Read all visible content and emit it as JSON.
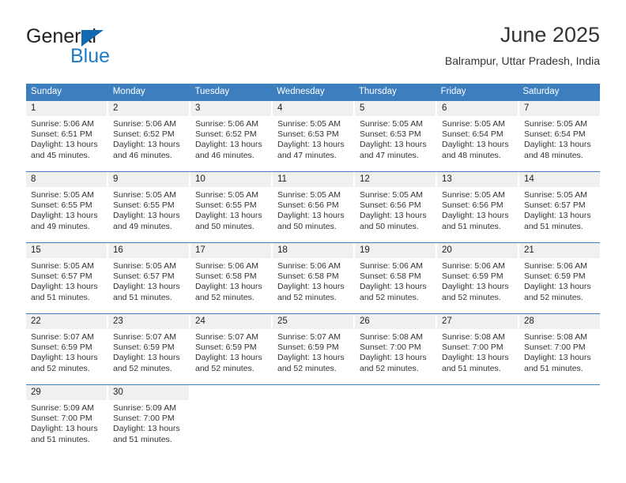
{
  "brand": {
    "name_top": "General",
    "name_bottom": "Blue",
    "accent_color": "#1269b0",
    "blue_text_color": "#1e7ac4"
  },
  "header": {
    "title": "June 2025",
    "subtitle": "Balrampur, Uttar Pradesh, India"
  },
  "theme": {
    "header_bar_color": "#3d7ebf",
    "day_number_bg": "#f0f0f0",
    "text_color": "#333333"
  },
  "calendar": {
    "weekdays": [
      "Sunday",
      "Monday",
      "Tuesday",
      "Wednesday",
      "Thursday",
      "Friday",
      "Saturday"
    ],
    "labels": {
      "sunrise": "Sunrise:",
      "sunset": "Sunset:",
      "daylight": "Daylight:"
    },
    "weeks": [
      [
        {
          "day": "1",
          "sunrise": "Sunrise: 5:06 AM",
          "sunset": "Sunset: 6:51 PM",
          "daylight_line1": "Daylight: 13 hours",
          "daylight_line2": "and 45 minutes."
        },
        {
          "day": "2",
          "sunrise": "Sunrise: 5:06 AM",
          "sunset": "Sunset: 6:52 PM",
          "daylight_line1": "Daylight: 13 hours",
          "daylight_line2": "and 46 minutes."
        },
        {
          "day": "3",
          "sunrise": "Sunrise: 5:06 AM",
          "sunset": "Sunset: 6:52 PM",
          "daylight_line1": "Daylight: 13 hours",
          "daylight_line2": "and 46 minutes."
        },
        {
          "day": "4",
          "sunrise": "Sunrise: 5:05 AM",
          "sunset": "Sunset: 6:53 PM",
          "daylight_line1": "Daylight: 13 hours",
          "daylight_line2": "and 47 minutes."
        },
        {
          "day": "5",
          "sunrise": "Sunrise: 5:05 AM",
          "sunset": "Sunset: 6:53 PM",
          "daylight_line1": "Daylight: 13 hours",
          "daylight_line2": "and 47 minutes."
        },
        {
          "day": "6",
          "sunrise": "Sunrise: 5:05 AM",
          "sunset": "Sunset: 6:54 PM",
          "daylight_line1": "Daylight: 13 hours",
          "daylight_line2": "and 48 minutes."
        },
        {
          "day": "7",
          "sunrise": "Sunrise: 5:05 AM",
          "sunset": "Sunset: 6:54 PM",
          "daylight_line1": "Daylight: 13 hours",
          "daylight_line2": "and 48 minutes."
        }
      ],
      [
        {
          "day": "8",
          "sunrise": "Sunrise: 5:05 AM",
          "sunset": "Sunset: 6:55 PM",
          "daylight_line1": "Daylight: 13 hours",
          "daylight_line2": "and 49 minutes."
        },
        {
          "day": "9",
          "sunrise": "Sunrise: 5:05 AM",
          "sunset": "Sunset: 6:55 PM",
          "daylight_line1": "Daylight: 13 hours",
          "daylight_line2": "and 49 minutes."
        },
        {
          "day": "10",
          "sunrise": "Sunrise: 5:05 AM",
          "sunset": "Sunset: 6:55 PM",
          "daylight_line1": "Daylight: 13 hours",
          "daylight_line2": "and 50 minutes."
        },
        {
          "day": "11",
          "sunrise": "Sunrise: 5:05 AM",
          "sunset": "Sunset: 6:56 PM",
          "daylight_line1": "Daylight: 13 hours",
          "daylight_line2": "and 50 minutes."
        },
        {
          "day": "12",
          "sunrise": "Sunrise: 5:05 AM",
          "sunset": "Sunset: 6:56 PM",
          "daylight_line1": "Daylight: 13 hours",
          "daylight_line2": "and 50 minutes."
        },
        {
          "day": "13",
          "sunrise": "Sunrise: 5:05 AM",
          "sunset": "Sunset: 6:56 PM",
          "daylight_line1": "Daylight: 13 hours",
          "daylight_line2": "and 51 minutes."
        },
        {
          "day": "14",
          "sunrise": "Sunrise: 5:05 AM",
          "sunset": "Sunset: 6:57 PM",
          "daylight_line1": "Daylight: 13 hours",
          "daylight_line2": "and 51 minutes."
        }
      ],
      [
        {
          "day": "15",
          "sunrise": "Sunrise: 5:05 AM",
          "sunset": "Sunset: 6:57 PM",
          "daylight_line1": "Daylight: 13 hours",
          "daylight_line2": "and 51 minutes."
        },
        {
          "day": "16",
          "sunrise": "Sunrise: 5:05 AM",
          "sunset": "Sunset: 6:57 PM",
          "daylight_line1": "Daylight: 13 hours",
          "daylight_line2": "and 51 minutes."
        },
        {
          "day": "17",
          "sunrise": "Sunrise: 5:06 AM",
          "sunset": "Sunset: 6:58 PM",
          "daylight_line1": "Daylight: 13 hours",
          "daylight_line2": "and 52 minutes."
        },
        {
          "day": "18",
          "sunrise": "Sunrise: 5:06 AM",
          "sunset": "Sunset: 6:58 PM",
          "daylight_line1": "Daylight: 13 hours",
          "daylight_line2": "and 52 minutes."
        },
        {
          "day": "19",
          "sunrise": "Sunrise: 5:06 AM",
          "sunset": "Sunset: 6:58 PM",
          "daylight_line1": "Daylight: 13 hours",
          "daylight_line2": "and 52 minutes."
        },
        {
          "day": "20",
          "sunrise": "Sunrise: 5:06 AM",
          "sunset": "Sunset: 6:59 PM",
          "daylight_line1": "Daylight: 13 hours",
          "daylight_line2": "and 52 minutes."
        },
        {
          "day": "21",
          "sunrise": "Sunrise: 5:06 AM",
          "sunset": "Sunset: 6:59 PM",
          "daylight_line1": "Daylight: 13 hours",
          "daylight_line2": "and 52 minutes."
        }
      ],
      [
        {
          "day": "22",
          "sunrise": "Sunrise: 5:07 AM",
          "sunset": "Sunset: 6:59 PM",
          "daylight_line1": "Daylight: 13 hours",
          "daylight_line2": "and 52 minutes."
        },
        {
          "day": "23",
          "sunrise": "Sunrise: 5:07 AM",
          "sunset": "Sunset: 6:59 PM",
          "daylight_line1": "Daylight: 13 hours",
          "daylight_line2": "and 52 minutes."
        },
        {
          "day": "24",
          "sunrise": "Sunrise: 5:07 AM",
          "sunset": "Sunset: 6:59 PM",
          "daylight_line1": "Daylight: 13 hours",
          "daylight_line2": "and 52 minutes."
        },
        {
          "day": "25",
          "sunrise": "Sunrise: 5:07 AM",
          "sunset": "Sunset: 6:59 PM",
          "daylight_line1": "Daylight: 13 hours",
          "daylight_line2": "and 52 minutes."
        },
        {
          "day": "26",
          "sunrise": "Sunrise: 5:08 AM",
          "sunset": "Sunset: 7:00 PM",
          "daylight_line1": "Daylight: 13 hours",
          "daylight_line2": "and 52 minutes."
        },
        {
          "day": "27",
          "sunrise": "Sunrise: 5:08 AM",
          "sunset": "Sunset: 7:00 PM",
          "daylight_line1": "Daylight: 13 hours",
          "daylight_line2": "and 51 minutes."
        },
        {
          "day": "28",
          "sunrise": "Sunrise: 5:08 AM",
          "sunset": "Sunset: 7:00 PM",
          "daylight_line1": "Daylight: 13 hours",
          "daylight_line2": "and 51 minutes."
        }
      ],
      [
        {
          "day": "29",
          "sunrise": "Sunrise: 5:09 AM",
          "sunset": "Sunset: 7:00 PM",
          "daylight_line1": "Daylight: 13 hours",
          "daylight_line2": "and 51 minutes."
        },
        {
          "day": "30",
          "sunrise": "Sunrise: 5:09 AM",
          "sunset": "Sunset: 7:00 PM",
          "daylight_line1": "Daylight: 13 hours",
          "daylight_line2": "and 51 minutes."
        },
        {
          "day": "",
          "sunrise": "",
          "sunset": "",
          "daylight_line1": "",
          "daylight_line2": ""
        },
        {
          "day": "",
          "sunrise": "",
          "sunset": "",
          "daylight_line1": "",
          "daylight_line2": ""
        },
        {
          "day": "",
          "sunrise": "",
          "sunset": "",
          "daylight_line1": "",
          "daylight_line2": ""
        },
        {
          "day": "",
          "sunrise": "",
          "sunset": "",
          "daylight_line1": "",
          "daylight_line2": ""
        },
        {
          "day": "",
          "sunrise": "",
          "sunset": "",
          "daylight_line1": "",
          "daylight_line2": ""
        }
      ]
    ]
  }
}
